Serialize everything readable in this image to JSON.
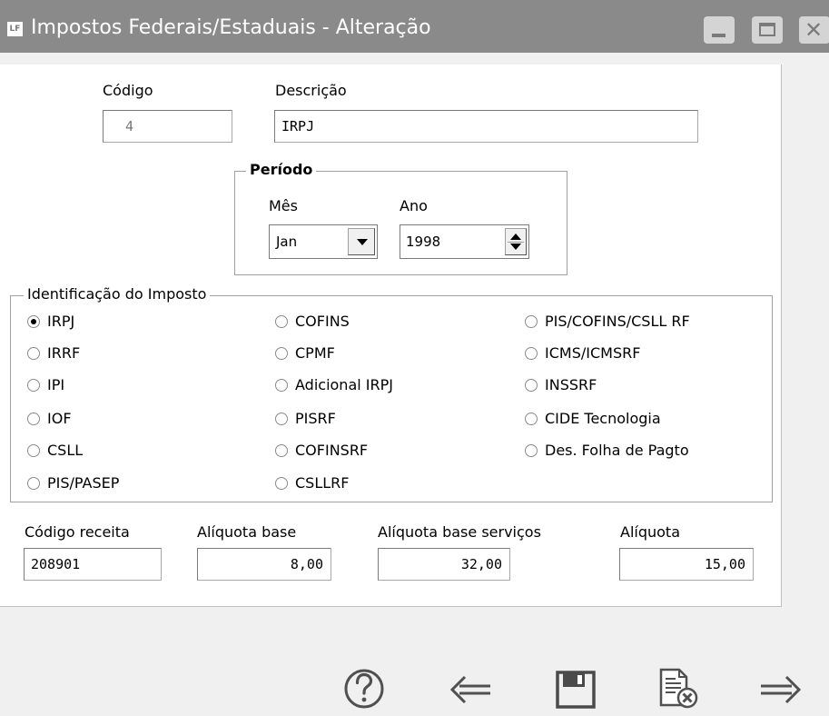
{
  "window": {
    "icon_text": "LF",
    "title": "Impostos Federais/Estaduais - Alteração"
  },
  "form": {
    "codigo": {
      "label": "Código",
      "value": "4"
    },
    "descricao": {
      "label": "Descrição",
      "value": "IRPJ"
    },
    "periodo": {
      "legend": "Período",
      "mes": {
        "label": "Mês",
        "value": "Jan"
      },
      "ano": {
        "label": "Ano",
        "value": "1998"
      }
    },
    "identificacao": {
      "legend": "Identificação do Imposto",
      "options": [
        {
          "label": "IRPJ",
          "checked": true
        },
        {
          "label": "IRRF",
          "checked": false
        },
        {
          "label": "IPI",
          "checked": false
        },
        {
          "label": "IOF",
          "checked": false
        },
        {
          "label": "CSLL",
          "checked": false
        },
        {
          "label": "PIS/PASEP",
          "checked": false
        },
        {
          "label": "COFINS",
          "checked": false
        },
        {
          "label": "CPMF",
          "checked": false
        },
        {
          "label": "Adicional IRPJ",
          "checked": false
        },
        {
          "label": "PISRF",
          "checked": false
        },
        {
          "label": "COFINSRF",
          "checked": false
        },
        {
          "label": "CSLLRF",
          "checked": false
        },
        {
          "label": "PIS/COFINS/CSLL RF",
          "checked": false
        },
        {
          "label": "ICMS/ICMSRF",
          "checked": false
        },
        {
          "label": "INSSRF",
          "checked": false
        },
        {
          "label": "CIDE Tecnologia",
          "checked": false
        },
        {
          "label": "Des. Folha de Pagto",
          "checked": false
        }
      ]
    },
    "codigo_receita": {
      "label": "Código receita",
      "value": "208901"
    },
    "aliquota_base": {
      "label": "Alíquota base",
      "value": "8,00"
    },
    "aliquota_base_servicos": {
      "label": "Alíquota base serviços",
      "value": "32,00"
    },
    "aliquota": {
      "label": "Alíquota",
      "value": "15,00"
    }
  },
  "toolbar": {
    "help_icon": "?",
    "buttons": [
      "help-icon",
      "back-arrow-icon",
      "save-icon",
      "cancel-document-icon",
      "forward-arrow-icon"
    ]
  },
  "colors": {
    "titlebar": "#8a8a8a",
    "window_bg": "#f0f0f0",
    "panel_bg": "#ffffff"
  }
}
